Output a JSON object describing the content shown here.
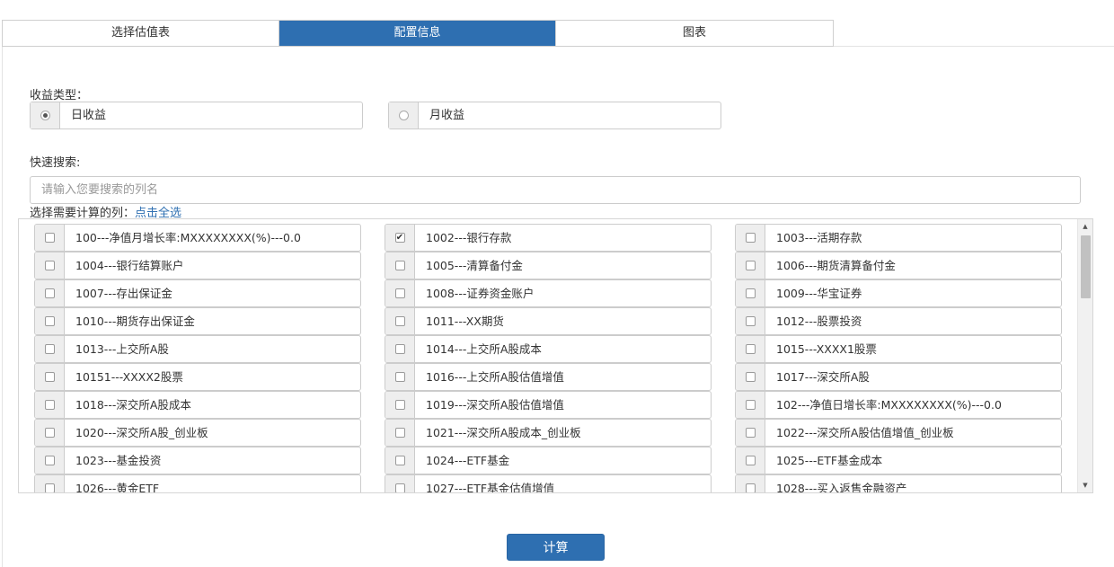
{
  "tabs": [
    {
      "label": "选择估值表"
    },
    {
      "label": "配置信息"
    },
    {
      "label": "图表"
    }
  ],
  "return_type": {
    "label": "收益类型：",
    "options": [
      {
        "label": "日收益",
        "selected": true
      },
      {
        "label": "月收益",
        "selected": false
      }
    ]
  },
  "quick_search": {
    "label": "快速搜索:",
    "placeholder": "请输入您要搜索的列名"
  },
  "columns_section": {
    "label": "选择需要计算的列：",
    "select_all": "点击全选"
  },
  "columns": [
    {
      "label": "100---净值月增长率:MXXXXXXXX(%)---0.0",
      "checked": false
    },
    {
      "label": "1002---银行存款",
      "checked": true
    },
    {
      "label": "1003---活期存款",
      "checked": false
    },
    {
      "label": "1004---银行结算账户",
      "checked": false
    },
    {
      "label": "1005---清算备付金",
      "checked": false
    },
    {
      "label": "1006---期货清算备付金",
      "checked": false
    },
    {
      "label": "1007---存出保证金",
      "checked": false
    },
    {
      "label": "1008---证券资金账户",
      "checked": false
    },
    {
      "label": "1009---华宝证券",
      "checked": false
    },
    {
      "label": "1010---期货存出保证金",
      "checked": false
    },
    {
      "label": "1011---XX期货",
      "checked": false
    },
    {
      "label": "1012---股票投资",
      "checked": false
    },
    {
      "label": "1013---上交所A股",
      "checked": false
    },
    {
      "label": "1014---上交所A股成本",
      "checked": false
    },
    {
      "label": "1015---XXXX1股票",
      "checked": false
    },
    {
      "label": "10151---XXXX2股票",
      "checked": false
    },
    {
      "label": "1016---上交所A股估值增值",
      "checked": false
    },
    {
      "label": "1017---深交所A股",
      "checked": false
    },
    {
      "label": "1018---深交所A股成本",
      "checked": false
    },
    {
      "label": "1019---深交所A股估值增值",
      "checked": false
    },
    {
      "label": "102---净值日增长率:MXXXXXXXX(%)---0.0",
      "checked": false
    },
    {
      "label": "1020---深交所A股_创业板",
      "checked": false
    },
    {
      "label": "1021---深交所A股成本_创业板",
      "checked": false
    },
    {
      "label": "1022---深交所A股估值增值_创业板",
      "checked": false
    },
    {
      "label": "1023---基金投资",
      "checked": false
    },
    {
      "label": "1024---ETF基金",
      "checked": false
    },
    {
      "label": "1025---ETF基金成本",
      "checked": false
    },
    {
      "label": "1026---黄金ETF",
      "checked": false
    },
    {
      "label": "1027---ETF基金估值增值",
      "checked": false
    },
    {
      "label": "1028---买入返售金融资产",
      "checked": false
    }
  ],
  "calculate_button": "计算",
  "icons": {
    "checkbox_checked": "checkmark-icon",
    "scroll_up": "triangle-up-icon",
    "scroll_down": "triangle-down-icon"
  },
  "colors": {
    "accent": "#2e6fb1",
    "addon_bg": "#eeeeee",
    "border": "#cccccc"
  }
}
